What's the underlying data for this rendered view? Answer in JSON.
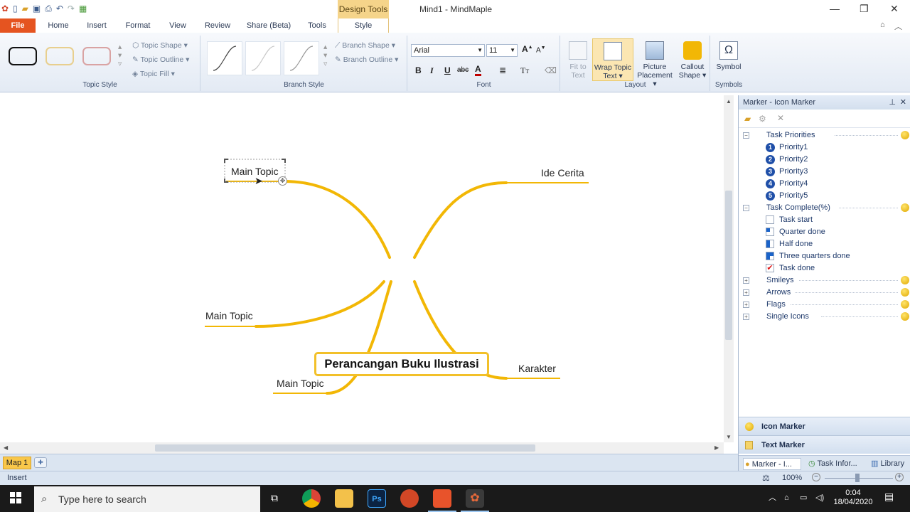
{
  "window": {
    "title": "Mind1 - MindMaple",
    "contextual_group": "Design Tools"
  },
  "tabs": [
    "File",
    "Home",
    "Insert",
    "Format",
    "View",
    "Review",
    "Share (Beta)",
    "Tools",
    "Style"
  ],
  "ribbon": {
    "topic_style": {
      "label": "Topic Style",
      "topic_shape": "Topic Shape",
      "topic_outline": "Topic Outline",
      "topic_fill": "Topic Fill"
    },
    "branch_style": {
      "label": "Branch Style",
      "branch_shape": "Branch Shape",
      "branch_outline": "Branch Outline"
    },
    "font": {
      "label": "Font",
      "family": "Arial",
      "size": "11",
      "bold": "B",
      "italic": "I",
      "underline": "U",
      "strike": "abc",
      "color": "A",
      "grow": "A",
      "shrink": "A"
    },
    "layout": {
      "label": "Layout",
      "fit_line1": "Fit to",
      "fit_line2": "Text",
      "wrap_line1": "Wrap Topic",
      "wrap_line2": "Text",
      "picture_line1": "Picture",
      "picture_line2": "Placement",
      "callout_line1": "Callout",
      "callout_line2": "Shape"
    },
    "symbols": {
      "label": "Symbols",
      "symbol": "Symbol"
    }
  },
  "mindmap": {
    "central": "Perancangan Buku Ilustrasi",
    "topics": {
      "main_topic_selected": "Main Topic",
      "ide_cerita": "Ide Cerita",
      "main_topic_left": "Main Topic",
      "main_topic_bottom": "Main Topic",
      "karakter": "Karakter"
    },
    "branch_color": "#F2B705"
  },
  "sheet_tab": "Map 1",
  "status": {
    "mode": "Insert",
    "zoom": "100%"
  },
  "panel": {
    "title": "Marker - Icon Marker",
    "groups": [
      {
        "label": "Task Priorities",
        "expanded": true,
        "items": [
          "Priority1",
          "Priority2",
          "Priority3",
          "Priority4",
          "Priority5"
        ]
      },
      {
        "label": "Task Complete(%)",
        "expanded": true,
        "items": [
          "Task start",
          "Quarter done",
          "Half done",
          "Three quarters done",
          "Task done"
        ]
      },
      {
        "label": "Smileys",
        "expanded": false,
        "items": []
      },
      {
        "label": "Arrows",
        "expanded": false,
        "items": []
      },
      {
        "label": "Flags",
        "expanded": false,
        "items": []
      },
      {
        "label": "Single Icons",
        "expanded": false,
        "items": []
      }
    ],
    "priority_numbers": [
      "1",
      "2",
      "3",
      "4",
      "5"
    ],
    "accordion": [
      "Icon Marker",
      "Text Marker"
    ],
    "bottom_tabs": [
      "Marker - I...",
      "Task Infor...",
      "Library"
    ]
  },
  "taskbar": {
    "search_placeholder": "Type here to search",
    "time": "0:04",
    "date": "18/04/2020"
  }
}
